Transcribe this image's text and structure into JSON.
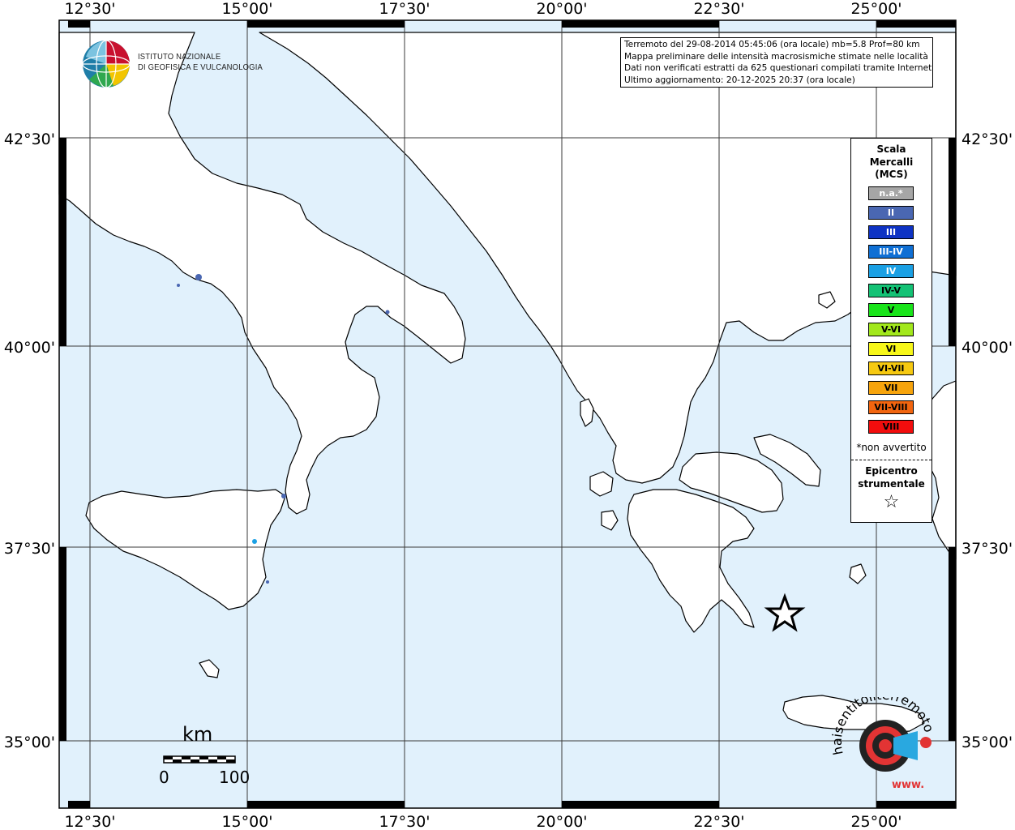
{
  "coordinates": {
    "top_labels": [
      "12°30'",
      "15°00'",
      "17°30'",
      "20°00'",
      "22°30'",
      "25°00'"
    ],
    "bottom_labels": [
      "12°30'",
      "15°00'",
      "17°30'",
      "20°00'",
      "22°30'",
      "25°00'"
    ],
    "left_labels": [
      "42°30'",
      "40°00'",
      "37°30'",
      "35°00'"
    ],
    "right_labels": [
      "42°30'",
      "40°00'",
      "37°30'",
      "35°00'"
    ]
  },
  "info": {
    "line1": "Terremoto del 29-08-2014 05:45:06 (ora locale) mb=5.8 Prof=80 km",
    "line2": "Mappa preliminare delle intensità macrosismiche stimate nelle località",
    "line3": "Dati non verificati estratti da 625 questionari compilati tramite Internet.",
    "line4": "Ultimo aggiornamento: 20-12-2025 20:37 (ora locale)"
  },
  "ingv": {
    "line1": "ISTITUTO NAZIONALE",
    "line2": "DI GEOFISICA E VULCANOLOGIA"
  },
  "legend": {
    "title1": "Scala",
    "title2": "Mercalli",
    "title3": "(MCS)",
    "classes": [
      {
        "label": "n.a.*",
        "color": "#a6a6a6",
        "text_color": "#ffffff"
      },
      {
        "label": "II",
        "color": "#4a67b2",
        "text_color": "#ffffff"
      },
      {
        "label": "III",
        "color": "#0e33c4",
        "text_color": "#ffffff"
      },
      {
        "label": "III-IV",
        "color": "#0f6fd4",
        "text_color": "#ffffff"
      },
      {
        "label": "IV",
        "color": "#1aa0e4",
        "text_color": "#ffffff"
      },
      {
        "label": "IV-V",
        "color": "#14c275",
        "text_color": "#000000"
      },
      {
        "label": "V",
        "color": "#19e41a",
        "text_color": "#000000"
      },
      {
        "label": "V-VI",
        "color": "#a2e81c",
        "text_color": "#000000"
      },
      {
        "label": "VI",
        "color": "#f7f719",
        "text_color": "#000000"
      },
      {
        "label": "VI-VII",
        "color": "#f6c911",
        "text_color": "#000000"
      },
      {
        "label": "VII",
        "color": "#f7a40c",
        "text_color": "#000000"
      },
      {
        "label": "VII-VIII",
        "color": "#f2650f",
        "text_color": "#000000"
      },
      {
        "label": "VIII",
        "color": "#f20d0d",
        "text_color": "#000000"
      }
    ],
    "note": "*non avvertito",
    "epicenter1": "Epicentro",
    "epicenter2": "strumentale",
    "star": "☆"
  },
  "scale": {
    "unit": "km",
    "start": "0",
    "end": "100"
  },
  "site_logo": {
    "text": "haisentitoilterremoto.it",
    "url_text": "www."
  },
  "colors": {
    "sea": "#e1f1fc",
    "land": "#ffffff",
    "grid": "#3a3a3a",
    "frame": "#000000"
  }
}
